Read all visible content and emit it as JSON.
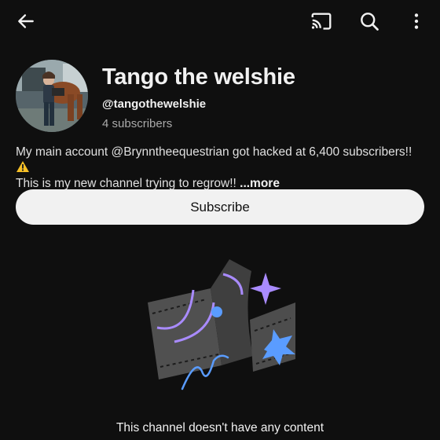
{
  "topbar": {
    "back_icon": "arrow-back-icon",
    "cast_icon": "cast-icon",
    "search_icon": "search-icon",
    "more_icon": "more-vertical-icon"
  },
  "channel": {
    "name": "Tango the welshie",
    "handle": "@tangothewelshie",
    "subscribers": "4 subscribers",
    "description_text": "My main account @Brynntheequestrian got hacked at 6,400 subscribers!! ",
    "description_text2": "This is my new channel trying to regrow!! ",
    "more_label": "...more",
    "warning_icon": "warning-icon"
  },
  "subscribe": {
    "label": "Subscribe"
  },
  "empty_state": {
    "illustration": "empty-channel-illustration",
    "message": "This channel doesn't have any content"
  },
  "colors": {
    "background": "#0f0f0f",
    "text": "#f1f1f1",
    "secondary_text": "#aaaaaa",
    "button_bg": "#f1f1f1",
    "accent_purple": "#a98bff",
    "accent_blue": "#5a9cff"
  }
}
